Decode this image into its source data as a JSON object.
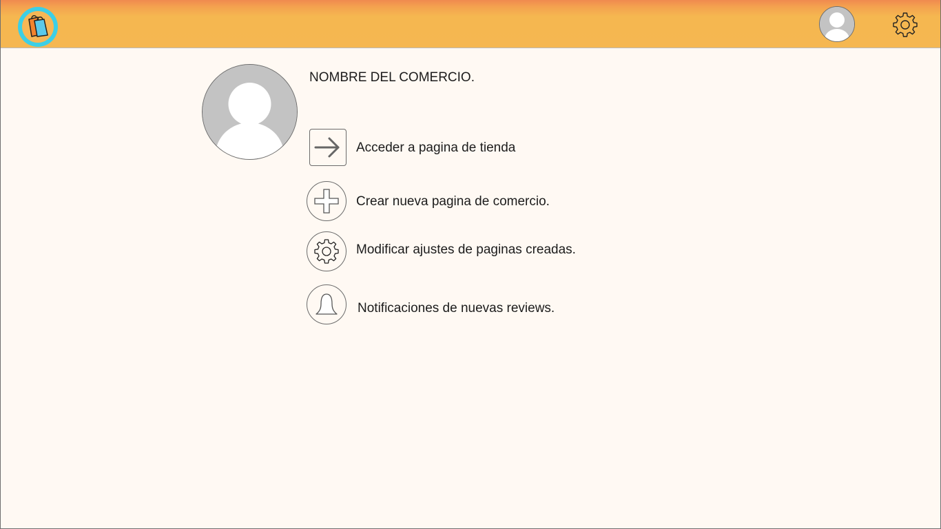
{
  "header": {
    "logo_icon": "shopping-bags-icon",
    "avatar_icon": "user-avatar-icon",
    "settings_icon": "gear-icon",
    "colors": {
      "bar": "#f5b751",
      "bar_top": "#f08a4f",
      "logo_ring": "#3ccfe6"
    }
  },
  "profile": {
    "store_name": "NOMBRE DEL COMERCIO.",
    "avatar_icon": "user-avatar-icon"
  },
  "actions": [
    {
      "label": "Acceder a pagina de tienda",
      "icon": "arrow-right-icon"
    },
    {
      "label": "Crear nueva pagina de comercio.",
      "icon": "plus-icon"
    },
    {
      "label": "Modificar ajustes de paginas creadas.",
      "icon": "gear-icon"
    },
    {
      "label": "Notificaciones de nuevas reviews.",
      "icon": "bell-icon"
    }
  ]
}
